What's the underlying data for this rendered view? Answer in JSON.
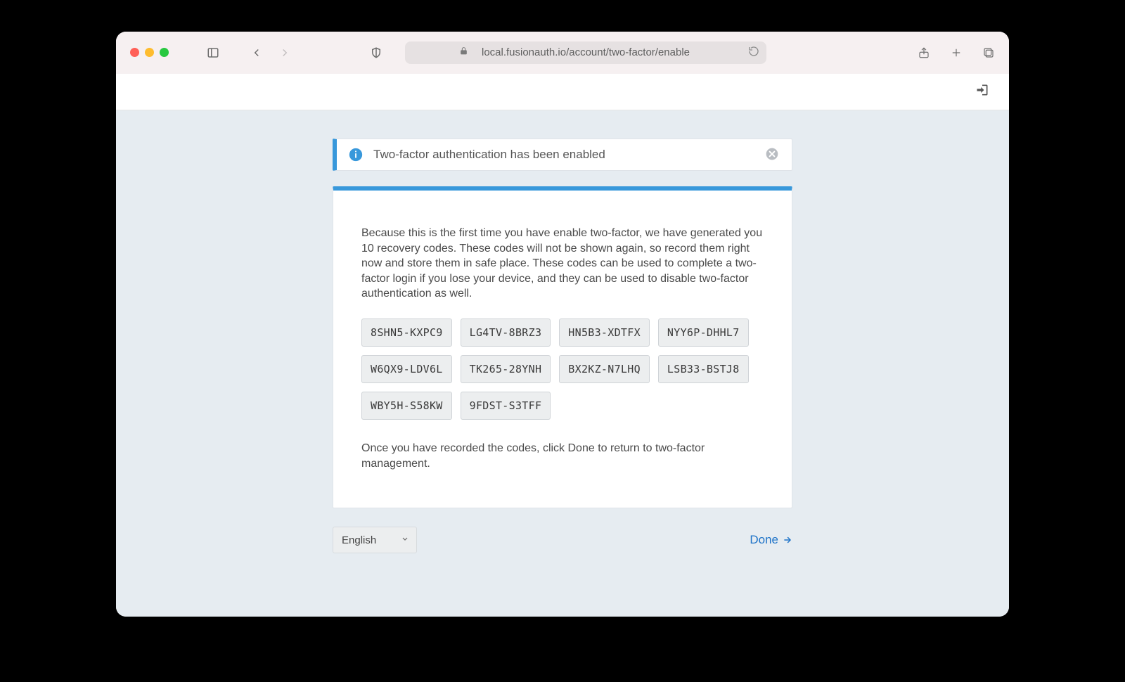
{
  "browser": {
    "url": "local.fusionauth.io/account/two-factor/enable"
  },
  "notice": {
    "message": "Two-factor authentication has been enabled"
  },
  "panel": {
    "intro": "Because this is the first time you have enable two-factor, we have generated you 10 recovery codes. These codes will not be shown again, so record them right now and store them in safe place. These codes can be used to complete a two-factor login if you lose your device, and they can be used to disable two-factor authentication as well.",
    "codes": [
      "8SHN5-KXPC9",
      "LG4TV-8BRZ3",
      "HN5B3-XDTFX",
      "NYY6P-DHHL7",
      "W6QX9-LDV6L",
      "TK265-28YNH",
      "BX2KZ-N7LHQ",
      "LSB33-BSTJ8",
      "WBY5H-S58KW",
      "9FDST-S3TFF"
    ],
    "footer": "Once you have recorded the codes, click Done to return to two-factor management."
  },
  "lang": {
    "selected": "English"
  },
  "actions": {
    "done_label": "Done"
  }
}
